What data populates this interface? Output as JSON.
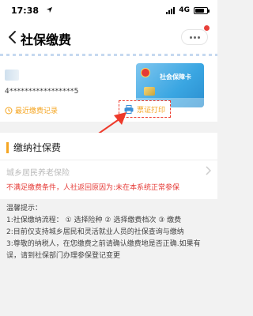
{
  "status_bar": {
    "time": "17:38",
    "network": "4G",
    "icons": [
      "location-arrow-icon",
      "signal-icon",
      "battery-icon"
    ]
  },
  "nav": {
    "title": "社保缴费",
    "back_icon": "chevron-left-icon",
    "more_icon": "more-dots-icon",
    "badge_color": "#e8403a"
  },
  "banner": {
    "id_number": "4*****************5",
    "card_name": "社会保障卡",
    "recent_records_label": "最近缴费记录",
    "print_label": "票证打印",
    "accent_color": "#f5a623",
    "highlight_color": "#ee3a2b"
  },
  "section": {
    "title": "缴纳社保费",
    "insurance_type": "城乡居民养老保险",
    "error_message": "不满足缴费条件，人社返回原因为:未在本系统正常参保",
    "error_color": "#e53935"
  },
  "tips": {
    "heading": "温馨提示：",
    "items": [
      "1:社保缴纳流程： ① 选择险种 ② 选择缴费档次 ③ 缴费",
      "2:目前仅支持城乡居民和灵活就业人员的社保查询与缴纳",
      "3:尊敬的纳税人，在您缴费之前请确认缴费地是否正确.如果有误，请到社保部门办理参保登记变更"
    ]
  }
}
